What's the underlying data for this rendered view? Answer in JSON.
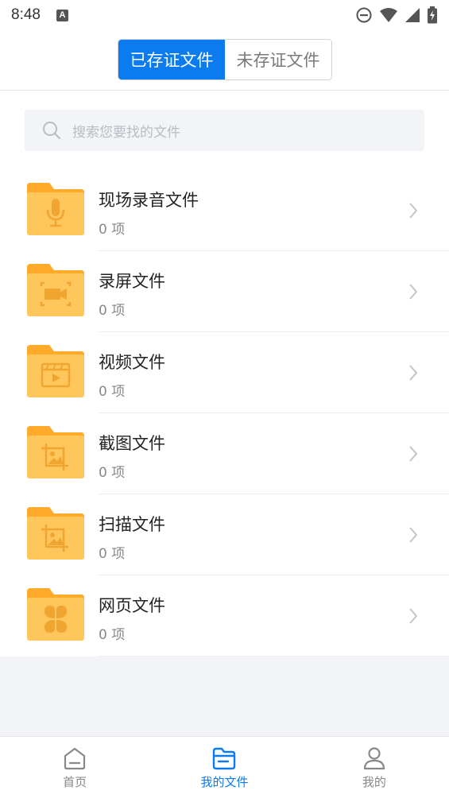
{
  "status_bar": {
    "time": "8:48",
    "icons": [
      "notification-a-icon",
      "do-not-disturb-icon",
      "wifi-icon",
      "signal-icon",
      "battery-charging-icon"
    ]
  },
  "header": {
    "tabs": [
      {
        "label": "已存证文件",
        "active": true
      },
      {
        "label": "未存证文件",
        "active": false
      }
    ]
  },
  "search": {
    "placeholder": "搜索您要找的文件",
    "icon": "search-icon"
  },
  "colors": {
    "accent": "#0a7cf0",
    "folder": "#ffc65c",
    "folder_tab": "#ffaa2b",
    "folder_icon": "#f0a530"
  },
  "files": {
    "items": [
      {
        "title": "现场录音文件",
        "count": "0 项",
        "icon": "microphone-icon"
      },
      {
        "title": "录屏文件",
        "count": "0 项",
        "icon": "screen-record-icon"
      },
      {
        "title": "视频文件",
        "count": "0 项",
        "icon": "video-clapper-icon"
      },
      {
        "title": "截图文件",
        "count": "0 项",
        "icon": "screenshot-crop-icon"
      },
      {
        "title": "扫描文件",
        "count": "0 项",
        "icon": "scan-image-icon"
      },
      {
        "title": "网页文件",
        "count": "0 项",
        "icon": "webpage-clover-icon"
      }
    ]
  },
  "bottom_nav": {
    "items": [
      {
        "label": "首页",
        "icon": "home-icon",
        "active": false
      },
      {
        "label": "我的文件",
        "icon": "folder-icon",
        "active": true
      },
      {
        "label": "我的",
        "icon": "person-icon",
        "active": false
      }
    ]
  }
}
